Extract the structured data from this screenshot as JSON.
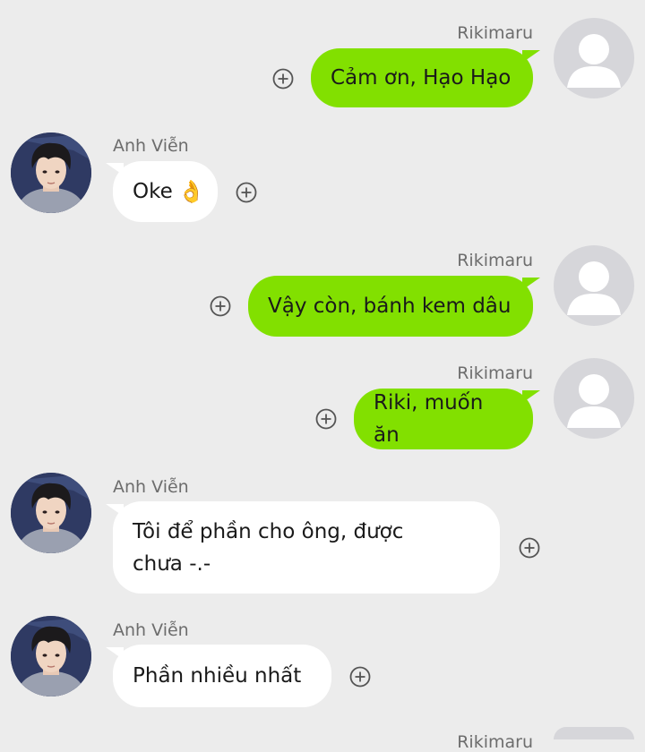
{
  "messages": [
    {
      "sender": "Rikimaru",
      "text": "Cảm ơn, Hạo Hạo"
    },
    {
      "sender": "Anh Viễn",
      "text": "Oke",
      "emoji": "👌"
    },
    {
      "sender": "Rikimaru",
      "text": "Vậy còn, bánh kem dâu"
    },
    {
      "sender": "Rikimaru",
      "text": "Riki, muốn ăn"
    },
    {
      "sender": "Anh Viễn",
      "text": "Tôi để phần cho ông, được chưa -.-"
    },
    {
      "sender": "Anh Viễn",
      "text": "Phần nhiều nhất"
    },
    {
      "sender": "Rikimaru",
      "text": ""
    }
  ],
  "icons": {
    "add": "plus-circle-icon",
    "default_avatar": "user-silhouette-icon"
  },
  "colors": {
    "background": "#ececec",
    "outgoing_bubble": "#82e000",
    "incoming_bubble": "#ffffff",
    "sender_name": "#6d6d6d"
  }
}
